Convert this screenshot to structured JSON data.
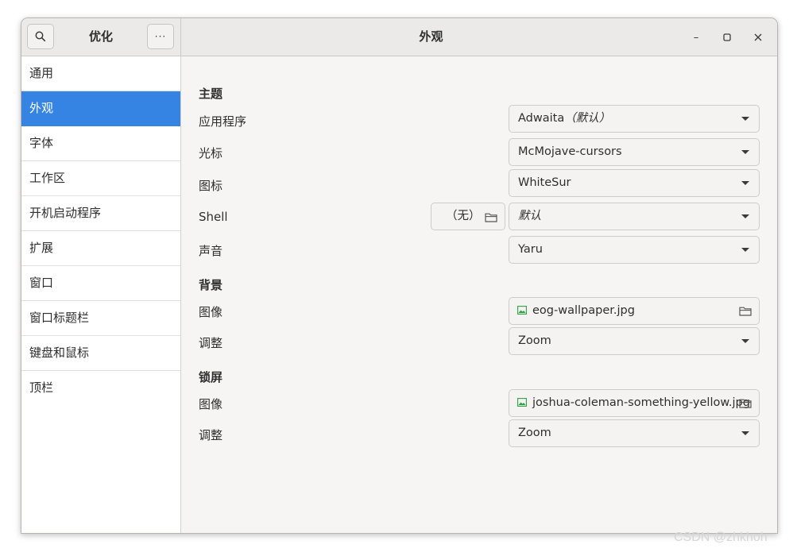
{
  "header": {
    "left_title": "优化",
    "title": "外观",
    "search_icon": "search-icon",
    "menu_icon": "ellipsis-icon",
    "menu_label": "···",
    "minimize_label": "–",
    "maximize_label": "▢",
    "close_label": "✕"
  },
  "sidebar": {
    "items": [
      {
        "label": "通用"
      },
      {
        "label": "外观"
      },
      {
        "label": "字体"
      },
      {
        "label": "工作区"
      },
      {
        "label": "开机启动程序"
      },
      {
        "label": "扩展"
      },
      {
        "label": "窗口"
      },
      {
        "label": "窗口标题栏"
      },
      {
        "label": "键盘和鼠标"
      },
      {
        "label": "顶栏"
      }
    ],
    "active_index": 1
  },
  "themes": {
    "heading": "主题",
    "applications": {
      "label": "应用程序",
      "value": "Adwaita",
      "value_suffix": "（默认）"
    },
    "cursor": {
      "label": "光标",
      "value": "McMojave-cursors"
    },
    "icons": {
      "label": "图标",
      "value": "WhiteSur"
    },
    "shell": {
      "label": "Shell",
      "none_label": "（无）",
      "value": "默认"
    },
    "sound": {
      "label": "声音",
      "value": "Yaru"
    }
  },
  "background": {
    "heading": "背景",
    "image": {
      "label": "图像",
      "value": "eog-wallpaper.jpg"
    },
    "adjust": {
      "label": "调整",
      "value": "Zoom"
    }
  },
  "lockscreen": {
    "heading": "锁屏",
    "image": {
      "label": "图像",
      "value": "joshua-coleman-something-yellow.jpg"
    },
    "adjust": {
      "label": "调整",
      "value": "Zoom"
    }
  },
  "watermark": "CSDN @zhkhoh",
  "colors": {
    "accent": "#3584e4",
    "image_icon": "#2ea043"
  }
}
